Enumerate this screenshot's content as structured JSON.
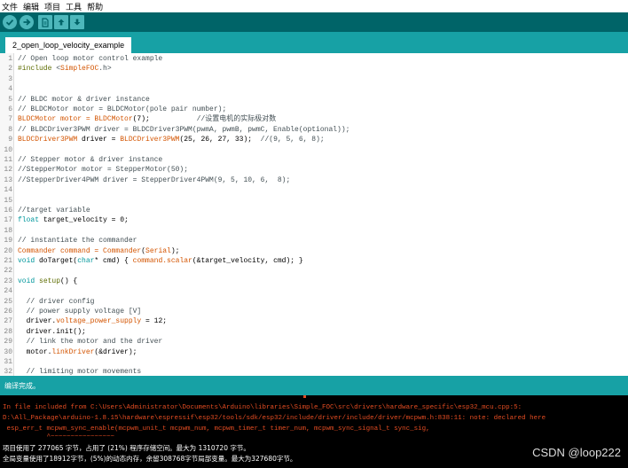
{
  "menu": [
    "文件",
    "编辑",
    "项目",
    "工具",
    "帮助"
  ],
  "tab": {
    "label": "2_open_loop_velocity_example"
  },
  "code_lines": [
    {
      "n": "1",
      "segs": [
        {
          "t": "// Open loop motor control example",
          "c": "#434f54"
        }
      ]
    },
    {
      "n": "2",
      "segs": [
        {
          "t": "#include ",
          "c": "#5e6d03"
        },
        {
          "t": "<",
          "c": "#434f54"
        },
        {
          "t": "SimpleFOC",
          "c": "#d35400"
        },
        {
          "t": ".h>",
          "c": "#434f54"
        }
      ]
    },
    {
      "n": "3",
      "segs": []
    },
    {
      "n": "4",
      "segs": []
    },
    {
      "n": "5",
      "segs": [
        {
          "t": "// BLDC motor & driver instance",
          "c": "#434f54"
        }
      ]
    },
    {
      "n": "6",
      "segs": [
        {
          "t": "// BLDCMotor motor = BLDCMotor(pole pair number);",
          "c": "#434f54"
        }
      ]
    },
    {
      "n": "7",
      "segs": [
        {
          "t": "BLDCMotor motor = BLDCMotor",
          "c": "#d35400"
        },
        {
          "t": "(7);           ",
          "c": "#000000"
        },
        {
          "t": "//设置电机的实际极对数",
          "c": "#434f54"
        }
      ]
    },
    {
      "n": "8",
      "segs": [
        {
          "t": "// BLDCDriver3PWM driver = BLDCDriver3PWM(pwmA, pwmB, pwmC, Enable(optional));",
          "c": "#434f54"
        }
      ]
    },
    {
      "n": "9",
      "segs": [
        {
          "t": "BLDCDriver3PWM",
          "c": "#d35400"
        },
        {
          "t": " driver = ",
          "c": "#000000"
        },
        {
          "t": "BLDCDriver3PWM",
          "c": "#d35400"
        },
        {
          "t": "(25, 26, 27, 33);  ",
          "c": "#000000"
        },
        {
          "t": "//(9, 5, 6, 8);",
          "c": "#434f54"
        }
      ]
    },
    {
      "n": "10",
      "segs": []
    },
    {
      "n": "11",
      "segs": [
        {
          "t": "// Stepper motor & driver instance",
          "c": "#434f54"
        }
      ]
    },
    {
      "n": "12",
      "segs": [
        {
          "t": "//StepperMotor motor = StepperMotor(50);",
          "c": "#434f54"
        }
      ]
    },
    {
      "n": "13",
      "segs": [
        {
          "t": "//StepperDriver4PWM driver = StepperDriver4PWM(9, 5, 10, 6,  8);",
          "c": "#434f54"
        }
      ]
    },
    {
      "n": "14",
      "segs": []
    },
    {
      "n": "15",
      "segs": []
    },
    {
      "n": "16",
      "segs": [
        {
          "t": "//target variable",
          "c": "#434f54"
        }
      ]
    },
    {
      "n": "17",
      "segs": [
        {
          "t": "float",
          "c": "#00979c"
        },
        {
          "t": " target_velocity = 0;",
          "c": "#000000"
        }
      ]
    },
    {
      "n": "18",
      "segs": []
    },
    {
      "n": "19",
      "segs": [
        {
          "t": "// instantiate the commander",
          "c": "#434f54"
        }
      ]
    },
    {
      "n": "20",
      "segs": [
        {
          "t": "Commander command = Commander",
          "c": "#d35400"
        },
        {
          "t": "(",
          "c": "#000000"
        },
        {
          "t": "Serial",
          "c": "#d35400"
        },
        {
          "t": ");",
          "c": "#000000"
        }
      ]
    },
    {
      "n": "21",
      "segs": [
        {
          "t": "void",
          "c": "#00979c"
        },
        {
          "t": " doTarget(",
          "c": "#000000"
        },
        {
          "t": "char",
          "c": "#00979c"
        },
        {
          "t": "* cmd) { ",
          "c": "#000000"
        },
        {
          "t": "command.scalar",
          "c": "#d35400"
        },
        {
          "t": "(&target_velocity, cmd); }",
          "c": "#000000"
        }
      ]
    },
    {
      "n": "22",
      "segs": []
    },
    {
      "n": "23",
      "segs": [
        {
          "t": "void",
          "c": "#00979c"
        },
        {
          "t": " ",
          "c": "#000000"
        },
        {
          "t": "setup",
          "c": "#5e6d03"
        },
        {
          "t": "() {",
          "c": "#000000"
        }
      ]
    },
    {
      "n": "24",
      "segs": []
    },
    {
      "n": "25",
      "segs": [
        {
          "t": "  // driver config",
          "c": "#434f54"
        }
      ]
    },
    {
      "n": "26",
      "segs": [
        {
          "t": "  // power supply voltage [V]",
          "c": "#434f54"
        }
      ]
    },
    {
      "n": "27",
      "segs": [
        {
          "t": "  driver.",
          "c": "#000000"
        },
        {
          "t": "voltage_power_supply",
          "c": "#d35400"
        },
        {
          "t": " = 12;",
          "c": "#000000"
        }
      ]
    },
    {
      "n": "28",
      "segs": [
        {
          "t": "  driver.init();",
          "c": "#000000"
        }
      ]
    },
    {
      "n": "29",
      "segs": [
        {
          "t": "  // link the motor and the driver",
          "c": "#434f54"
        }
      ]
    },
    {
      "n": "30",
      "segs": [
        {
          "t": "  motor.",
          "c": "#000000"
        },
        {
          "t": "linkDriver",
          "c": "#d35400"
        },
        {
          "t": "(&driver);",
          "c": "#000000"
        }
      ]
    },
    {
      "n": "31",
      "segs": []
    },
    {
      "n": "32",
      "segs": [
        {
          "t": "  // limiting motor movements",
          "c": "#434f54"
        }
      ]
    }
  ],
  "status": {
    "text": "编译完成。"
  },
  "console": [
    {
      "t": "In file included from C:\\Users\\Administrator\\Documents\\Arduino\\libraries\\Simple_FOC\\src\\drivers\\hardware_specific\\esp32_mcu.cpp:5:",
      "c": "#e34c22"
    },
    {
      "t": "D:\\All_Package\\arduino-1.8.15\\hardware\\espressif\\esp32/tools/sdk/esp32/include/driver/include/driver/mcpwm.h:838:11: note: declared here",
      "c": "#e34c22"
    },
    {
      "t": " esp_err_t mcpwm_sync_enable(mcpwm_unit_t mcpwm_num, mcpwm_timer_t timer_num, mcpwm_sync_signal_t sync_sig,",
      "c": "#e34c22"
    },
    {
      "t": "           ^~~~~~~~~~~~~~~~~",
      "c": "#e34c22"
    },
    {
      "t": "项目使用了 277065 字节，占用了 (21%) 程序存储空间。最大为 1310720 字节。",
      "c": "#ffffff"
    },
    {
      "t": "全局变量使用了18912字节，(5%)的动态内存，余留308768字节局部变量。最大为327680字节。",
      "c": "#ffffff"
    }
  ],
  "watermark": "CSDN @loop222",
  "colors": {
    "toolbar": "#006468",
    "tabbar": "#17a1a5",
    "button": "#4db7bb",
    "keyword": "#00979c",
    "function": "#d35400",
    "comment": "#434f54",
    "error": "#e34c22"
  },
  "icons": [
    "verify-icon",
    "upload-icon",
    "new-file-icon",
    "open-icon",
    "save-icon"
  ]
}
